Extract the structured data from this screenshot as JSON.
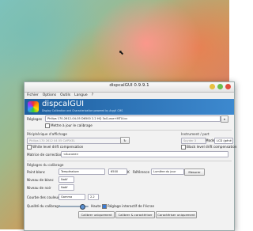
{
  "window": {
    "title": "dispcalGUI 0.9.9.1"
  },
  "menu": [
    "Fichier",
    "Options",
    "Outils",
    "Langue",
    "?"
  ],
  "banner": {
    "name": "dispcalGUI",
    "tagline": "Display Calibration and Characterization powered by Argyll CMS"
  },
  "settings": {
    "label": "Réglages",
    "value": "Philips 170-2612-04-05 D6500 2.2 HQ 3xCurve+MTX.icc"
  },
  "reset_cb": "Mettre à jour le calibrage",
  "display": {
    "label": "Périphérique d'affichage",
    "value": "Philips 170 2612 04 05 C#PIXEL"
  },
  "instrument": {
    "label": "Instrument / port",
    "value": "Spyder 3",
    "mode_label": "Mode",
    "mode_value": "LCD (géné"
  },
  "white_drift": "White level drift compensation",
  "black_drift": "Black level drift compensation",
  "correction": {
    "label": "Matrice de correction",
    "value": "<Aucune>"
  },
  "calib": {
    "section": "Réglages du calibrage",
    "whitepoint_label": "Point blanc",
    "whitepoint_mode": "Température",
    "whitepoint_temp": "6500",
    "k": "K",
    "reference_label": "Référence",
    "reference_value": "Lumière du jour",
    "measure": "Mesurer",
    "white_level_label": "Niveau de blanc",
    "white_level_value": "Natif",
    "black_level_label": "Niveau de noir",
    "black_level_value": "Natif",
    "curve_label": "Courbe des couleurs",
    "curve_value": "Gamma",
    "gamma_value": "2.2"
  },
  "quality": {
    "label": "Qualité du calibrage",
    "value": "Haute",
    "interactive": "Réglage interactif de l'écran"
  },
  "actions": {
    "calibrate": "Calibrer uniquement",
    "calib_profile": "Calibrer & caractériser",
    "profile": "Caractériser uniquement"
  }
}
